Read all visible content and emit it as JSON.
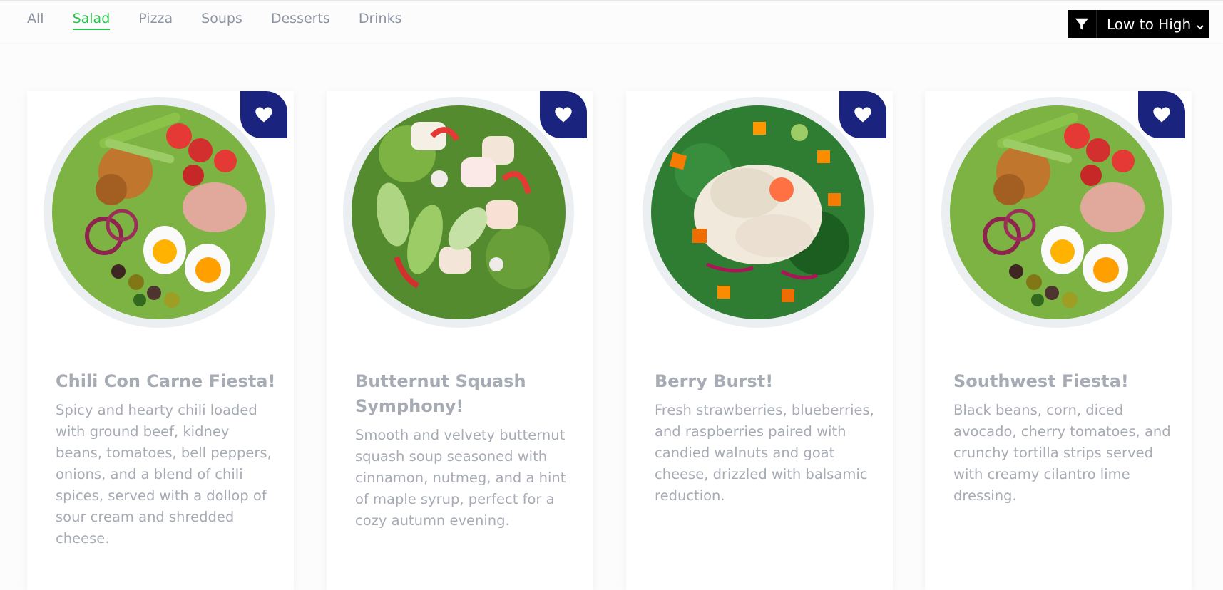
{
  "tabs": [
    {
      "label": "All",
      "active": false
    },
    {
      "label": "Salad",
      "active": true
    },
    {
      "label": "Pizza",
      "active": false
    },
    {
      "label": "Soups",
      "active": false
    },
    {
      "label": "Desserts",
      "active": false
    },
    {
      "label": "Drinks",
      "active": false
    }
  ],
  "sort": {
    "filter_icon": "filter-icon",
    "selected": "Low to High"
  },
  "colors": {
    "accent": "#27c24c",
    "favorite_bg": "#1a237e",
    "text_muted": "#a6abb4",
    "tab_inactive": "#8c93a0"
  },
  "cards": [
    {
      "title": "Chili Con Carne Fiesta!",
      "description": "Spicy and hearty chili loaded with ground beef, kidney beans, tomatoes, bell peppers, onions, and a blend of chili spices, served with a dollop of sour cream and shredded cheese.",
      "image": "nicoise-salad-bowl",
      "favorite_icon": "heart-icon"
    },
    {
      "title": "Butternut Squash Symphony!",
      "description": "Smooth and velvety butternut squash soup seasoned with cinnamon, nutmeg, and a hint of maple syrup, perfect for a cozy autumn evening.",
      "image": "chicken-avocado-salad-bowl",
      "favorite_icon": "heart-icon"
    },
    {
      "title": "Berry Burst!",
      "description": "Fresh strawberries, blueberries, and raspberries paired with candied walnuts and goat cheese, drizzled with balsamic reduction.",
      "image": "kale-chicken-salad-bowl",
      "favorite_icon": "heart-icon"
    },
    {
      "title": "Southwest Fiesta!",
      "description": "Black beans, corn, diced avocado, cherry tomatoes, and crunchy tortilla strips served with creamy cilantro lime dressing.",
      "image": "nicoise-salad-bowl",
      "favorite_icon": "heart-icon"
    }
  ]
}
